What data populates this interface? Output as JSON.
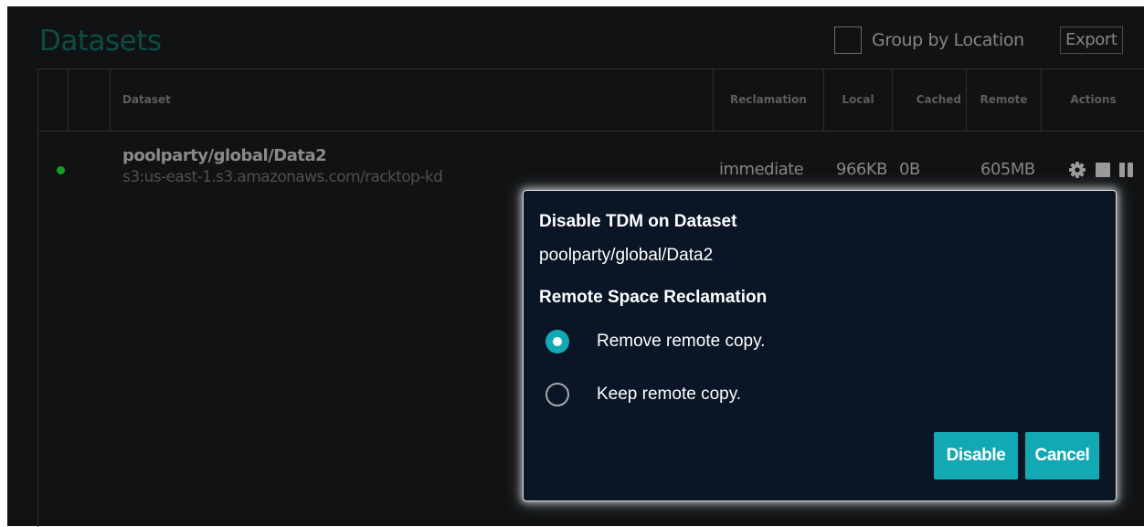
{
  "header": {
    "title": "Datasets",
    "group_by_label": "Group by Location",
    "export_label": "Export"
  },
  "table": {
    "columns": [
      "Dataset",
      "Reclamation",
      "Local",
      "Cached",
      "Remote",
      "Actions"
    ],
    "rows": [
      {
        "status": "online",
        "name": "poolparty/global/Data2",
        "location": "s3:us-east-1.s3.amazonaws.com/racktop-kd",
        "reclamation": "immediate",
        "local": "966KB",
        "cached": "0B",
        "remote": "605MB",
        "actions": [
          "gear-icon",
          "stop-icon",
          "pause-icon"
        ]
      }
    ]
  },
  "modal": {
    "title": "Disable TDM on Dataset",
    "dataset": "poolparty/global/Data2",
    "section_label": "Remote Space Reclamation",
    "options": [
      {
        "label": "Remove remote copy.",
        "selected": true
      },
      {
        "label": "Keep remote copy.",
        "selected": false
      }
    ],
    "disable_label": "Disable",
    "cancel_label": "Cancel"
  },
  "colors": {
    "accent": "#13a9b4",
    "status_online": "#1a9b26",
    "background": "#101213",
    "modal_background": "#0a1525"
  }
}
